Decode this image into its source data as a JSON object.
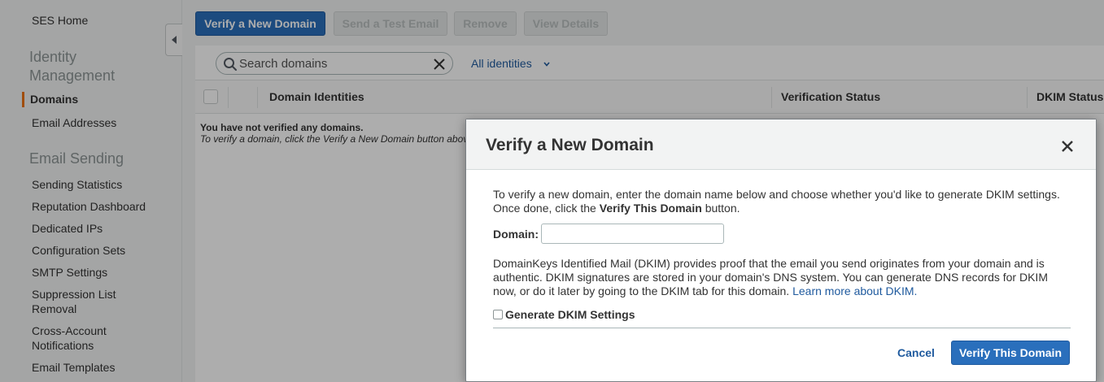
{
  "sidebar": {
    "home": "SES Home",
    "identity_section": "Identity Management",
    "identity_items": [
      "Domains",
      "Email Addresses"
    ],
    "active_item": "Domains",
    "sending_section": "Email Sending",
    "sending_items": [
      "Sending Statistics",
      "Reputation Dashboard",
      "Dedicated IPs",
      "Configuration Sets",
      "SMTP Settings",
      "Suppression List Removal",
      "Cross-Account Notifications",
      "Email Templates"
    ],
    "accent_color": "#ec7211"
  },
  "toolbar": {
    "verify_label": "Verify a New Domain",
    "test_email_label": "Send a Test Email",
    "remove_label": "Remove",
    "details_label": "View Details"
  },
  "search": {
    "placeholder": "Search domains",
    "value": ""
  },
  "filter": {
    "label": "All identities"
  },
  "table": {
    "columns": [
      "Domain Identities",
      "Verification Status",
      "DKIM Status"
    ],
    "empty_title": "You have not verified any domains.",
    "empty_subtitle": "To verify a domain, click the Verify a New Domain button above."
  },
  "modal": {
    "title": "Verify a New Domain",
    "intro_text": "To verify a new domain, enter the domain name below and choose whether you'd like to generate DKIM settings. Once done, click the",
    "intro_bold": "Verify This Domain",
    "intro_end": "button.",
    "domain_label": "Domain:",
    "domain_value": "",
    "dkim_text": "DomainKeys Identified Mail (DKIM) provides proof that the email you send originates from your domain and is authentic. DKIM signatures are stored in your domain's DNS system. You can generate DNS records for DKIM now, or do it later by going to the DKIM tab for this domain.",
    "dkim_link": "Learn more about DKIM.",
    "dkim_checkbox_label": "Generate DKIM Settings",
    "dkim_checked": false,
    "cancel_label": "Cancel",
    "submit_label": "Verify This Domain"
  },
  "colors": {
    "primary": "#2a6fbc",
    "link": "#1f5a9e"
  }
}
